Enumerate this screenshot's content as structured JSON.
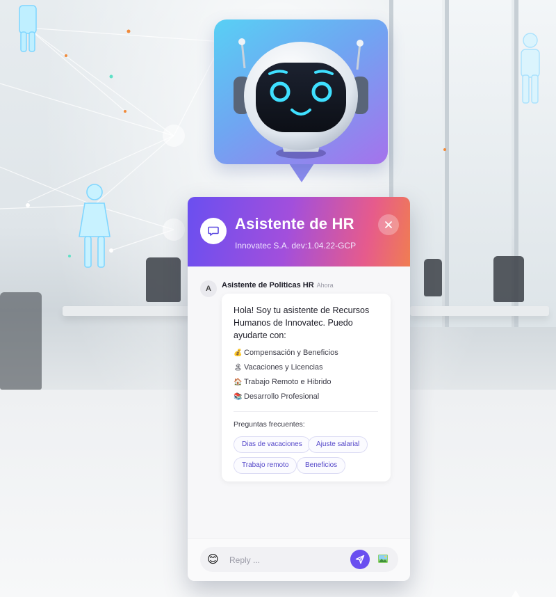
{
  "header": {
    "title": "Asistente de HR",
    "subtitle": "Innovatec S.A. dev:1.04.22-GCP",
    "close_icon": "close-icon",
    "chat_icon": "chat-bubble-icon"
  },
  "message": {
    "avatar_letter": "A",
    "sender": "Asistente de Politicas HR",
    "time": "Ahora",
    "intro": "Hola! Soy tu asistente de Recursos Humanos de Innovatec. Puedo ayudarte con:",
    "topics": [
      {
        "icon": "money-bag-icon",
        "emoji": "💰",
        "label": "Compensación y Beneficios"
      },
      {
        "icon": "palm-tree-icon",
        "emoji": "🏝",
        "label": "Vacaciones y Licencias"
      },
      {
        "icon": "home-icon",
        "emoji": "🏠",
        "label": "Trabajo Remoto e Hibrido"
      },
      {
        "icon": "books-icon",
        "emoji": "📚",
        "label": "Desarrollo Profesional"
      }
    ],
    "faq_title": "Preguntas frecuentes:",
    "faq_chips": [
      "Dias de vacaciones",
      "Ajuste salarial",
      "Trabajo remoto",
      "Beneficios"
    ]
  },
  "footer": {
    "placeholder": "Reply ...",
    "emoji_icon": "smiley-icon",
    "send_icon": "send-icon",
    "image_icon": "image-icon"
  },
  "colors": {
    "accent": "#6a4ff0",
    "header_gradient_start": "#6a4ff0",
    "header_gradient_end": "#f07d52",
    "chip_text": "#5447c9"
  }
}
